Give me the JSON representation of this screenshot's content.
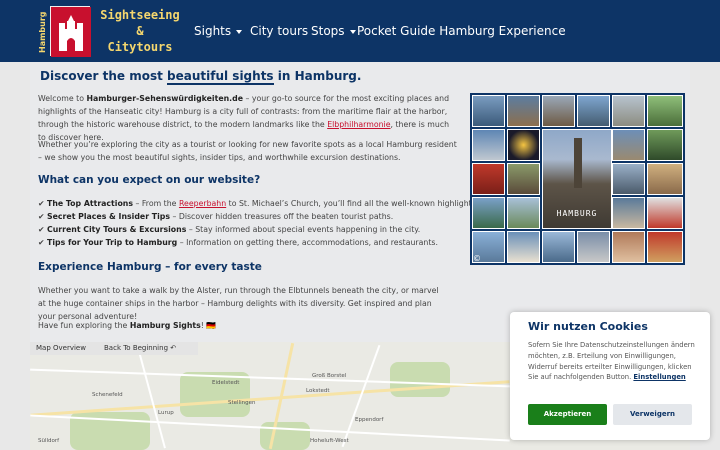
{
  "logo": {
    "vertical_text": "Hamburg",
    "line1": "Sightseeing",
    "line2": "&",
    "line3": "Citytours"
  },
  "nav": {
    "sights": "Sights",
    "city_tours": "City tours",
    "stops": "Stops",
    "pocket_guide": "Pocket Guide Hamburg Experience"
  },
  "main": {
    "title_pre": "Discover the most ",
    "title_hl": "beautiful sights",
    "title_post": " in Hamburg.",
    "intro": {
      "p1a": "Welcome to ",
      "site": "Hamburger-Sehenswürdigkeiten.de",
      "p1b": " – your go-to source for the most exciting places and highlights of the Hanseatic city! Hamburg is a city full of contrasts: from the maritime flair at the harbor, through the historic warehouse district, to the modern landmarks like the ",
      "elbphil": "Elbphilharmonie",
      "p1c": ", there is much to discover here."
    },
    "p2": "Whether you’re exploring the city as a tourist or looking for new favorite spots as a local Hamburg resident – we show you the most beautiful sights, insider tips, and worthwhile excursion destinations.",
    "h_expect": "What can you expect on our website?",
    "list": [
      {
        "check": "✔",
        "bold": "The Top Attractions",
        "pre": " – From the ",
        "link": "Reeperbahn",
        "post": " to St. Michael’s Church, you’ll find all the well-known highlights here."
      },
      {
        "check": "✔",
        "bold": "Secret Places & Insider Tips",
        "text": " – Discover hidden treasures off the beaten tourist paths."
      },
      {
        "check": "✔",
        "bold": "Current City Tours & Excursions",
        "text": " – Stay informed about special events happening in the city."
      },
      {
        "check": "✔",
        "bold": "Tips for Your Trip to Hamburg",
        "text": " – Information on getting there, accommodations, and restaurants."
      }
    ],
    "h_experience": "Experience Hamburg – for every taste",
    "p3": "Whether you want to take a walk by the Alster, run through the Elbtunnels beneath the city, or marvel at the huge container ships in the harbor – Hamburg delights with its diversity. Get inspired and plan your personal adventure!",
    "p4_pre": "Have fun exploring the ",
    "p4_bold": "Hamburg Sights",
    "p4_post": "! 🇩🇪"
  },
  "collage": {
    "label": "HAMBURG",
    "copyright": "©"
  },
  "map": {
    "overview": "Map Overview",
    "back": "Back To Beginning ↶",
    "places": [
      "Schenefeld",
      "Eidelstedt",
      "Lokstedt",
      "Groß Borstel",
      "Lurup",
      "Stellingen",
      "Eppendorf",
      "Sülldorf",
      "Hoheluft-West"
    ]
  },
  "cookie": {
    "title": "Wir nutzen Cookies",
    "text": "Sofern Sie Ihre Datenschutzeinstellungen ändern möchten, z.B. Erteilung von Einwilligungen, Widerruf bereits erteilter Einwilligungen, klicken Sie auf nachfolgenden Button.",
    "settings": "Einstellungen",
    "accept": "Akzeptieren",
    "reject": "Verweigern"
  },
  "colors": {
    "nav_bg": "#0d3466",
    "accent_red": "#c8102e",
    "accept_green": "#1a7f1a"
  }
}
